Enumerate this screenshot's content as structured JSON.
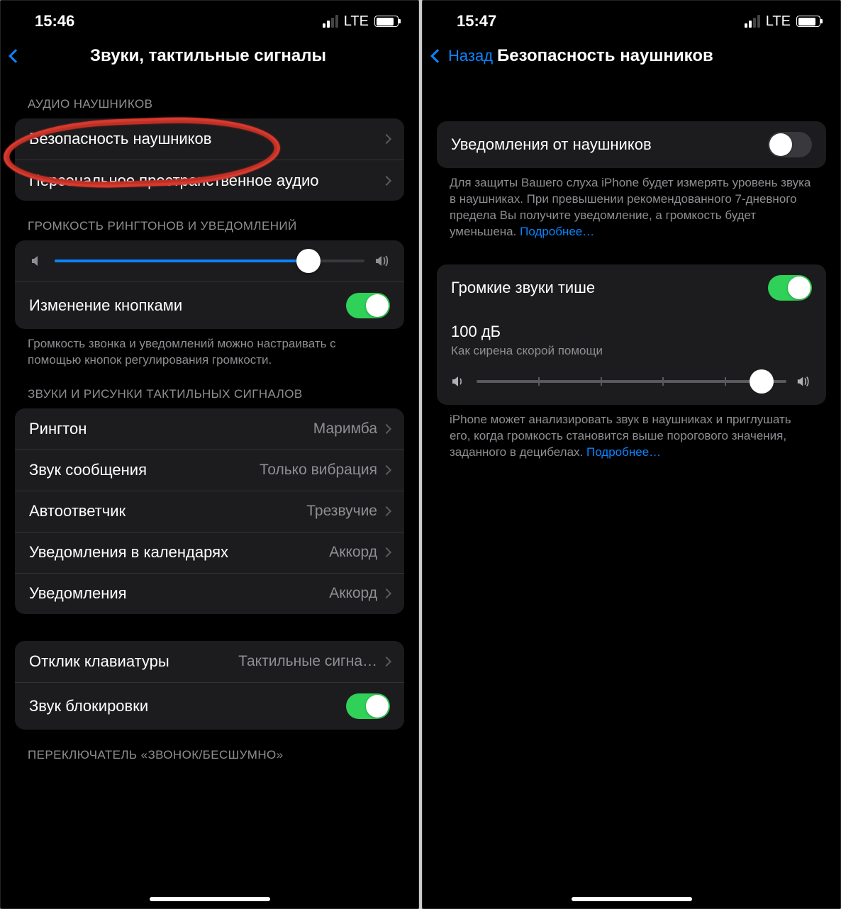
{
  "left": {
    "status": {
      "time": "15:46",
      "net": "LTE"
    },
    "title": "Звуки, тактильные сигналы",
    "sec_headphones": "АУДИО НАУШНИКОВ",
    "row_safety": "Безопасность наушников",
    "row_spatial": "Персональное пространственное аудио",
    "sec_volume": "ГРОМКОСТЬ РИНГТОНОВ И УВЕДОМЛЕНИЙ",
    "row_change_buttons": "Изменение кнопками",
    "volume_footer": "Громкость звонка и уведомлений можно настраивать с помощью кнопок регулирования громкости.",
    "sec_sounds": "ЗВУКИ И РИСУНКИ ТАКТИЛЬНЫХ СИГНАЛОВ",
    "ringtone": {
      "l": "Рингтон",
      "v": "Маримба"
    },
    "text": {
      "l": "Звук сообщения",
      "v": "Только вибрация"
    },
    "voicemail": {
      "l": "Автоответчик",
      "v": "Трезвучие"
    },
    "calendar": {
      "l": "Уведомления в календарях",
      "v": "Аккорд"
    },
    "notif": {
      "l": "Уведомления",
      "v": "Аккорд"
    },
    "keyboard": {
      "l": "Отклик клавиатуры",
      "v": "Тактильные сигна…"
    },
    "lock": "Звук блокировки",
    "sec_switch": "ПЕРЕКЛЮЧАТЕЛЬ «ЗВОНОК/БЕСШУМНО»"
  },
  "right": {
    "status": {
      "time": "15:47",
      "net": "LTE"
    },
    "back": "Назад",
    "title": "Безопасность наушников",
    "row_notif": "Уведомления от наушников",
    "notif_footer": "Для защиты Вашего слуха iPhone будет измерять уровень звука в наушниках. При превышении рекомендованного 7-дневного предела Вы получите уведомление, а громкость будет уменьшена.",
    "more": "Подробнее…",
    "row_reduce": "Громкие звуки тише",
    "db_value": "100 дБ",
    "db_desc": "Как сирена скорой помощи",
    "reduce_footer": "iPhone может анализировать звук в наушниках и приглушать его, когда громкость становится выше порогового значения, заданного в децибелах."
  }
}
